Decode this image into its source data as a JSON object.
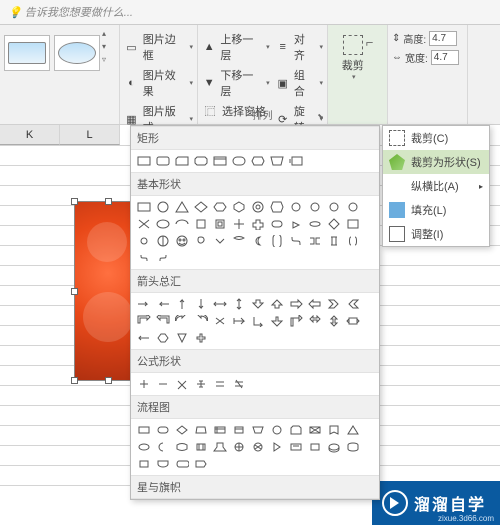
{
  "tell_placeholder": "告诉我您想要做什么...",
  "ribbon": {
    "picture_border": "图片边框",
    "picture_effect": "图片效果",
    "picture_layout": "图片版式",
    "bring_forward": "上移一层",
    "send_backward": "下移一层",
    "selection_pane": "选择窗格",
    "align": "对齐",
    "group": "组合",
    "rotate": "旋转",
    "arrange_label": "排列",
    "crop": "裁剪",
    "height": "高度:",
    "width": "宽度:",
    "h_val": "4.7",
    "w_val": "4.7"
  },
  "cols": {
    "k": "K",
    "l": "L"
  },
  "crop_menu": {
    "crop": "裁剪(C)",
    "crop_to_shape": "裁剪为形状(S)",
    "aspect": "纵横比(A)",
    "fill": "填充(L)",
    "fit": "调整(I)"
  },
  "shape_headers": {
    "rect": "矩形",
    "basic": "基本形状",
    "arrows": "箭头总汇",
    "equation": "公式形状",
    "flow": "流程图",
    "stars": "星与旗帜"
  },
  "watermark": {
    "text": "溜溜自学",
    "url": "zixue.3d66.com"
  }
}
